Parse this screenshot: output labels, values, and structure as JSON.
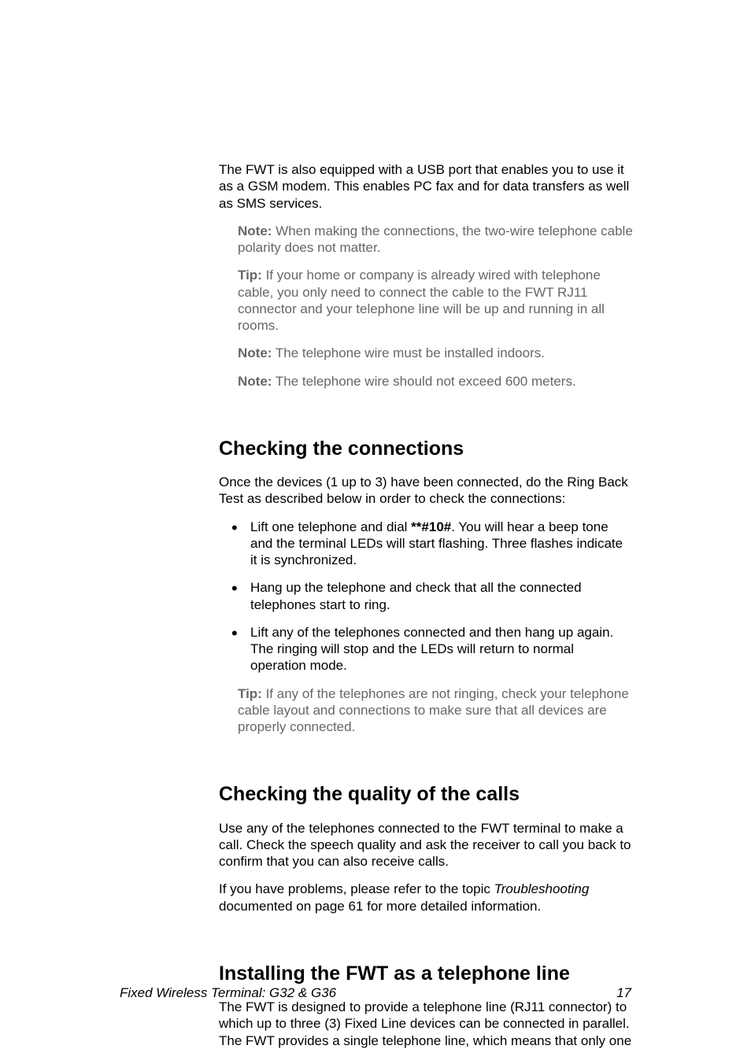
{
  "intro_paragraph": "The FWT is also equipped with a USB port that enables you to use it as a GSM modem.  This enables PC fax and for data transfers as well as SMS services.",
  "note_blocks": [
    {
      "label": "Note:",
      "text": " When making the connections, the two-wire telephone cable polarity does not matter."
    },
    {
      "label": "Tip:",
      "text": " If your home or company is already wired with telephone cable, you only need to connect the cable to the FWT RJ11 connector and your telephone line will be up and running in all rooms."
    },
    {
      "label": "Note:",
      "text": " The telephone wire must be installed indoors."
    },
    {
      "label": "Note:",
      "text": " The telephone wire should not exceed 600 meters."
    }
  ],
  "section1": {
    "heading": "Checking the connections",
    "intro": "Once the devices (1 up to 3) have been connected, do the Ring Back Test as described below in order to check the connections:",
    "bullets": {
      "b1_pre": "Lift one telephone and dial ",
      "b1_bold": "**#10#",
      "b1_post": ". You will hear a beep tone and the terminal LEDs will start flashing.  Three flashes indicate it is synchronized.",
      "b2": "Hang up the telephone and check that all the connected telephones start to ring.",
      "b3": "Lift any of the telephones connected and then hang up again. The ringing will stop and the LEDs will return to normal operation mode."
    },
    "tip": {
      "label": "Tip:",
      "text": " If any of the telephones are not ringing, check your telephone cable layout and connections to make sure that all devices are properly connected."
    }
  },
  "section2": {
    "heading": "Checking the quality of the calls",
    "p1": "Use any of the telephones connected to the FWT terminal to make a call. Check the speech quality and ask the receiver to call you back to confirm that you can also receive calls.",
    "p2_pre": "If you have problems, please refer to the topic ",
    "p2_italic": "Troubleshooting",
    "p2_post": " documented on page 61 for more detailed information."
  },
  "section3": {
    "heading": "Installing the FWT as a telephone line",
    "p1": "The FWT is designed to provide a telephone line (RJ11 connector) to which up to three (3) Fixed Line devices can be connected in parallel. The FWT provides a single telephone line, which means that only one"
  },
  "footer": {
    "title": "Fixed Wireless Terminal: G32 & G36",
    "page": "17"
  }
}
